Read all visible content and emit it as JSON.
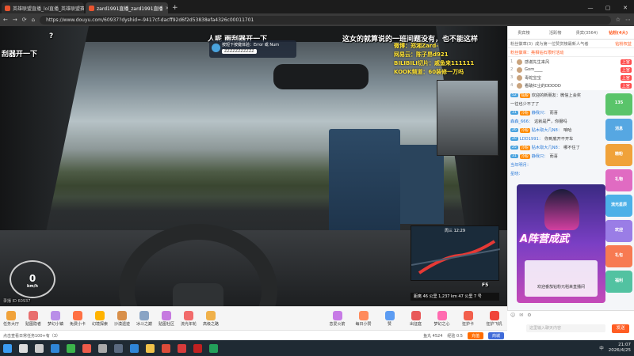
{
  "browser": {
    "tabs": [
      {
        "label": "英雄联盟直播_lol直播_英雄联盟赛",
        "active": false
      },
      {
        "label": "zard1991直播_zard1991直播",
        "active": true
      }
    ],
    "new_tab": "+",
    "window_controls": [
      "—",
      "▢",
      "✕"
    ],
    "url": "https://www.douyu.com/60937?dyshid=-9417cf-dacff92d6f2d53838efa4326c00011701",
    "nav": [
      "←",
      "→",
      "⟳",
      "⌂"
    ]
  },
  "video": {
    "overlay_top": "人呢 雨刮器开一下",
    "overlay_left": "刮器开一下",
    "overlay_right": "这女的就算说的一班间题没有，也不能这样",
    "q_mark": "?",
    "panel": {
      "title": "按短下按键体验：Error 或 Num",
      "text": "ZZZZZZZZZZZ"
    },
    "stream_info": [
      "微博：郑湘Zard-",
      "网易云：陈子昂d921",
      "BILIBILI切片：戚鱼来111111",
      "KOOK频道：60装修一万吗"
    ],
    "map_time": "周三 12:29",
    "map_bar": "距离 46 公里  1,237 km   47 公里 7 号",
    "f5": "F5",
    "speed": "0",
    "speed_unit": "km/h",
    "bottom_left": "录播 ID 60937"
  },
  "giftbar": {
    "gifts": [
      {
        "label": "任务大厅",
        "color": "#f0a23a"
      },
      {
        "label": "贴图隐者",
        "color": "#e86e6e"
      },
      {
        "label": "梦幻小镇",
        "color": "#b98ee8"
      },
      {
        "label": "免费小卡",
        "color": "#ff7043"
      },
      {
        "label": "幻境探索",
        "color": "#ffb300"
      },
      {
        "label": "沙漠遗迹",
        "color": "#d88f4a"
      },
      {
        "label": "冰斗之巅",
        "color": "#8aa4c4"
      },
      {
        "label": "贴图社区",
        "color": "#c67ae0"
      },
      {
        "label": "流光年轮",
        "color": "#f26b6b"
      },
      {
        "label": "高级之路",
        "color": "#f0b14a"
      }
    ],
    "right_gifts": [
      {
        "label": "恋爱火箭",
        "color": "#c77be6"
      },
      {
        "label": "每日小赞",
        "color": "#ff8b5c"
      },
      {
        "label": "赞",
        "color": "#5c9cf2"
      },
      {
        "label": "出征庭",
        "color": "#e85a5a"
      },
      {
        "label": "梦幻之心",
        "color": "#ff6bb0"
      },
      {
        "label": "狂护卡",
        "color": "#f25f4c"
      },
      {
        "label": "狂护飞机",
        "color": "#f0443a"
      }
    ]
  },
  "infobar": {
    "left": "点击查看日常任务100+有（3）",
    "fish": "鱼丸 4524",
    "exp": "经验 0.5",
    "charge": "充值",
    "shop": "商城"
  },
  "sidebar": {
    "tabs": [
      "贵宾榜",
      "活跃榜",
      "贵宾(3564)",
      "钻粉(4大)"
    ],
    "sub_left": "粉丝徽章(3)",
    "sub_mid": "成为第一位赞赏榜最新人气者",
    "sub_right": "钻粉权益",
    "fans_msg": "粉丝徽章：亮相钻石限时活动",
    "rank": [
      {
        "n": "1",
        "name": "感谢先生来风",
        "badge": "上官"
      },
      {
        "n": "2",
        "name": "Gom____",
        "badge": "上官"
      },
      {
        "n": "3",
        "name": "毒蛇宝宝",
        "badge": "上官"
      },
      {
        "n": "4",
        "name": "看破红尘的DDDDD",
        "badge": "上官"
      }
    ],
    "chat": [
      {
        "lv": "52",
        "badge": "钻粉",
        "user": "",
        "text": "欢迎的新朋友：微信上会奖"
      },
      {
        "lv": "",
        "badge": "",
        "user": "",
        "text": "一往也少不了了"
      },
      {
        "lv": "31",
        "badge": "冷粉",
        "user": "静我只：",
        "text": "而喜"
      },
      {
        "lv": "",
        "badge": "",
        "user": "森森_666：",
        "text": "这就是严，你服吗"
      },
      {
        "lv": "26",
        "badge": "冷粉",
        "user": "贴木取大几N8：",
        "text": "咱哈"
      },
      {
        "lv": "20",
        "badge": "",
        "user": "LDD1991：",
        "text": "你到底开不开车"
      },
      {
        "lv": "25",
        "badge": "冷粉",
        "user": "贴木取大几N8：",
        "text": "哪不住了"
      },
      {
        "lv": "31",
        "badge": "冷粉",
        "user": "静我只：",
        "text": "而喜"
      },
      {
        "lv": "",
        "badge": "",
        "user": "当年明月：",
        "text": ""
      },
      {
        "lv": "",
        "badge": "",
        "user": "星晓：",
        "text": ""
      }
    ],
    "promo_title": "A阵营成武",
    "promo_text": "欢迎番茄钻粉元稻来直播间",
    "ads": [
      {
        "label": "135",
        "color": "#5ac46a"
      },
      {
        "label": "消息",
        "color": "#56a7e2"
      },
      {
        "label": "精粉",
        "color": "#f0a23a"
      },
      {
        "label": "礼物",
        "color": "#e06bc2"
      },
      {
        "label": "流光星辰",
        "color": "#4cb0e8"
      },
      {
        "label": "欢迎",
        "color": "#9a7de6"
      },
      {
        "label": "礼包",
        "color": "#f77a52"
      },
      {
        "label": "福利",
        "color": "#52c2a1"
      }
    ],
    "input_placeholder": "这里输入聊天内容",
    "send": "发送",
    "input_icons": [
      "☺",
      "✉",
      "⚙"
    ]
  },
  "taskbar": {
    "icons": [
      {
        "name": "windows-icon",
        "color": "#3b9cf2"
      },
      {
        "name": "search-icon",
        "color": "#dddddd"
      },
      {
        "name": "taskview-icon",
        "color": "#cccccc"
      },
      {
        "name": "edge-icon",
        "color": "#2f86d8"
      },
      {
        "name": "wechat-icon",
        "color": "#3cb44b"
      },
      {
        "name": "app-icon",
        "color": "#ee5b4a"
      },
      {
        "name": "cross-icon",
        "color": "#aaaaaa"
      },
      {
        "name": "steam-icon",
        "color": "#5a6a80"
      },
      {
        "name": "edge-icon",
        "color": "#2f86d8"
      },
      {
        "name": "folder-icon",
        "color": "#f0c24a"
      },
      {
        "name": "chrome-icon",
        "color": "#dd4b39"
      },
      {
        "name": "netease-icon",
        "color": "#d63b3b"
      },
      {
        "name": "red-icon",
        "color": "#c02020"
      },
      {
        "name": "terminal-icon",
        "color": "#23a05a"
      }
    ],
    "time": "21:07",
    "date": "2026/4/25",
    "tray": "中"
  }
}
